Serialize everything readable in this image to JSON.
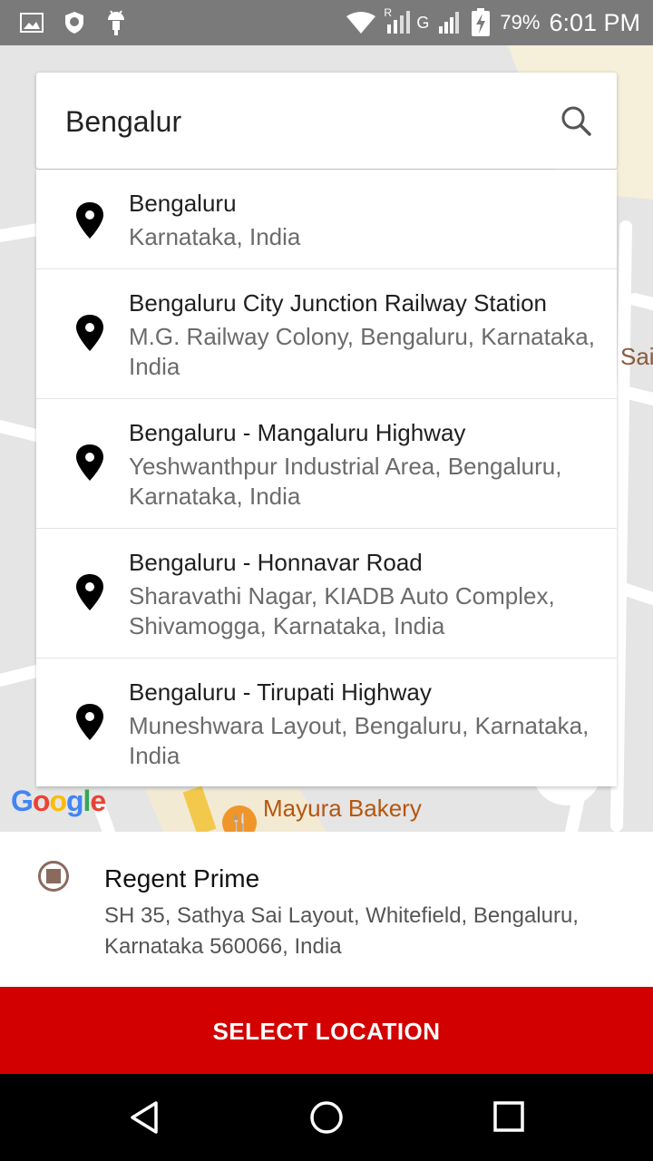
{
  "status_bar": {
    "battery_percent": "79%",
    "time": "6:01 PM",
    "network_label": "G",
    "roaming_label": "R",
    "icons": [
      "image-icon",
      "shield-icon",
      "android-icon",
      "wifi-icon",
      "signal-icon",
      "signal-icon",
      "battery-charging-icon"
    ]
  },
  "search": {
    "query": "Bengalur",
    "icon": "search-icon"
  },
  "suggestions": [
    {
      "title": "Bengaluru",
      "subtitle": "Karnataka, India"
    },
    {
      "title": "Bengaluru City Junction Railway Station",
      "subtitle": "M.G. Railway Colony, Bengaluru, Karnataka, India"
    },
    {
      "title": "Bengaluru - Mangaluru Highway",
      "subtitle": "Yeshwanthpur Industrial Area, Bengaluru, Karnataka, India"
    },
    {
      "title": "Bengaluru - Honnavar Road",
      "subtitle": "Sharavathi Nagar, KIADB Auto Complex, Shivamogga, Karnataka, India"
    },
    {
      "title": "Bengaluru - Tirupati Highway",
      "subtitle": "Muneshwara Layout, Bengaluru, Karnataka, India"
    }
  ],
  "map": {
    "logo": "Google",
    "label_sai": "Sai",
    "label_mayura": "Mayura Bakery"
  },
  "selected_place": {
    "name": "Regent Prime",
    "address": "SH 35, Sathya Sai Layout, Whitefield, Bengaluru, Karnataka 560066, India"
  },
  "action": {
    "select_label": "SELECT LOCATION"
  },
  "colors": {
    "accent": "#d30000",
    "radio": "#8b6a5e"
  }
}
